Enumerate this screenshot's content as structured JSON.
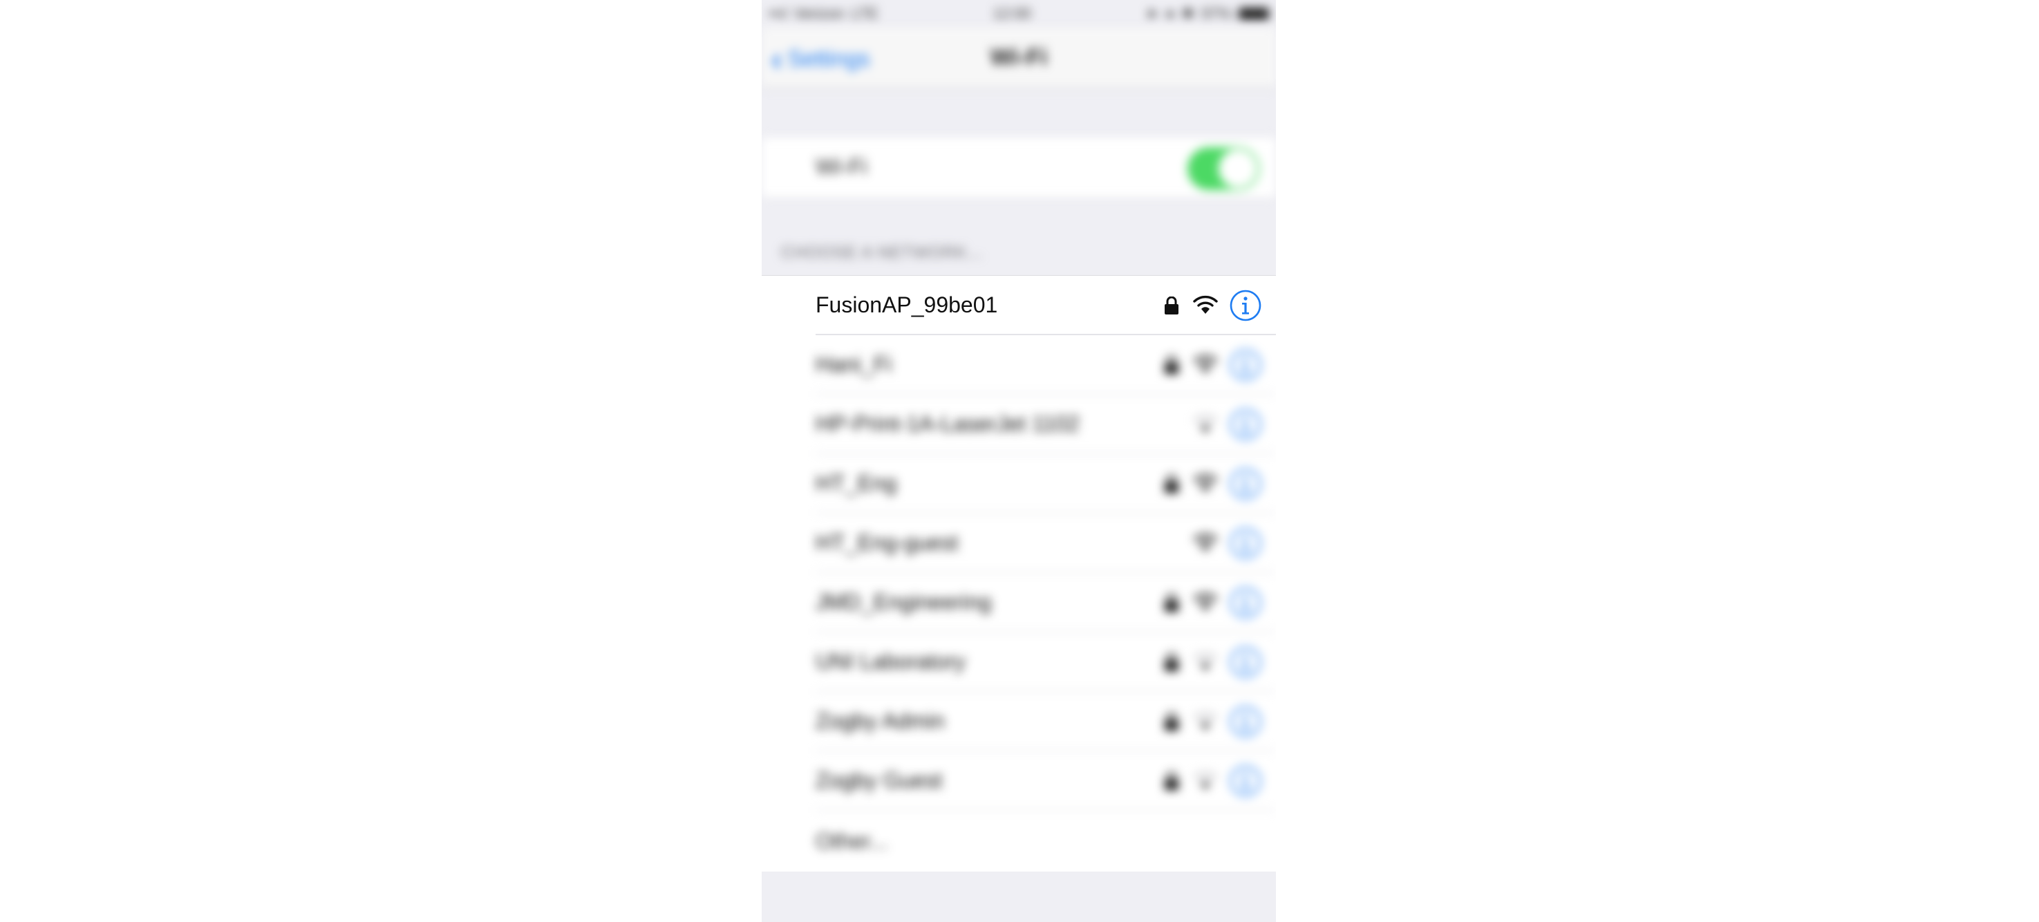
{
  "status_bar": {
    "carrier": "Verizon",
    "network_type": "LTE",
    "time": "12:00",
    "battery": "97%"
  },
  "nav": {
    "back_label": "Settings",
    "title": "Wi-Fi"
  },
  "wifi_toggle": {
    "label": "Wi-Fi",
    "enabled": true,
    "on_color": "#4cd964"
  },
  "section_header": "CHOOSE A NETWORK...",
  "networks": [
    {
      "name": "FusionAP_99be01",
      "secured": true,
      "signal": "full"
    },
    {
      "name": "Hani_Fi",
      "secured": true,
      "signal": "full"
    },
    {
      "name": "HP-Print-1A-LaserJet 1102",
      "secured": false,
      "signal": "low"
    },
    {
      "name": "HT_Eng",
      "secured": true,
      "signal": "full"
    },
    {
      "name": "HT_Eng-guest",
      "secured": false,
      "signal": "full"
    },
    {
      "name": "JMD_Engineering",
      "secured": true,
      "signal": "full"
    },
    {
      "name": "UNI Laboratory",
      "secured": true,
      "signal": "low"
    },
    {
      "name": "Zogby Admin",
      "secured": true,
      "signal": "low"
    },
    {
      "name": "Zogby Guest",
      "secured": true,
      "signal": "low"
    }
  ],
  "other_label": "Other...",
  "colors": {
    "accent": "#1e7cf2",
    "background": "#efeff4"
  }
}
